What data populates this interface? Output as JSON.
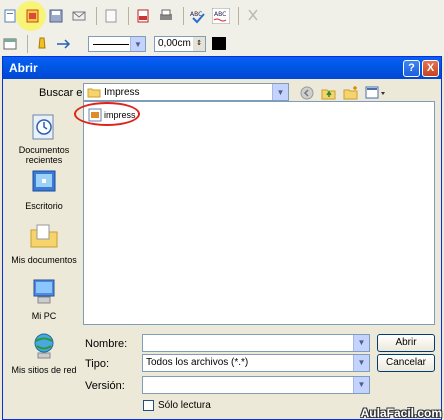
{
  "toolbar": {
    "line_width_value": "0,00cm",
    "highlight_color": "#f8f46b"
  },
  "dialog": {
    "title": "Abrir",
    "help_glyph": "?",
    "close_glyph": "X",
    "lookin_label": "Buscar en:",
    "lookin_value": "Impress",
    "places": [
      {
        "label": "Documentos recientes",
        "icon": "recent-documents-icon"
      },
      {
        "label": "Escritorio",
        "icon": "desktop-icon"
      },
      {
        "label": "Mis documentos",
        "icon": "my-documents-icon"
      },
      {
        "label": "Mi PC",
        "icon": "my-computer-icon"
      },
      {
        "label": "Mis sitios de red",
        "icon": "network-places-icon"
      }
    ],
    "files": [
      {
        "name": "impress",
        "icon": "impress-file-icon"
      }
    ],
    "filename_label": "Nombre:",
    "filename_value": "",
    "filetype_label": "Tipo:",
    "filetype_value": "Todos los archivos (*.*)",
    "version_label": "Versión:",
    "version_value": "",
    "readonly_label": "Sólo lectura",
    "open_button": "Abrir",
    "cancel_button": "Cancelar"
  },
  "watermark": "AulaFacil.com",
  "colors": {
    "title_bar": "#0058e6",
    "annotation": "#e0221c"
  }
}
